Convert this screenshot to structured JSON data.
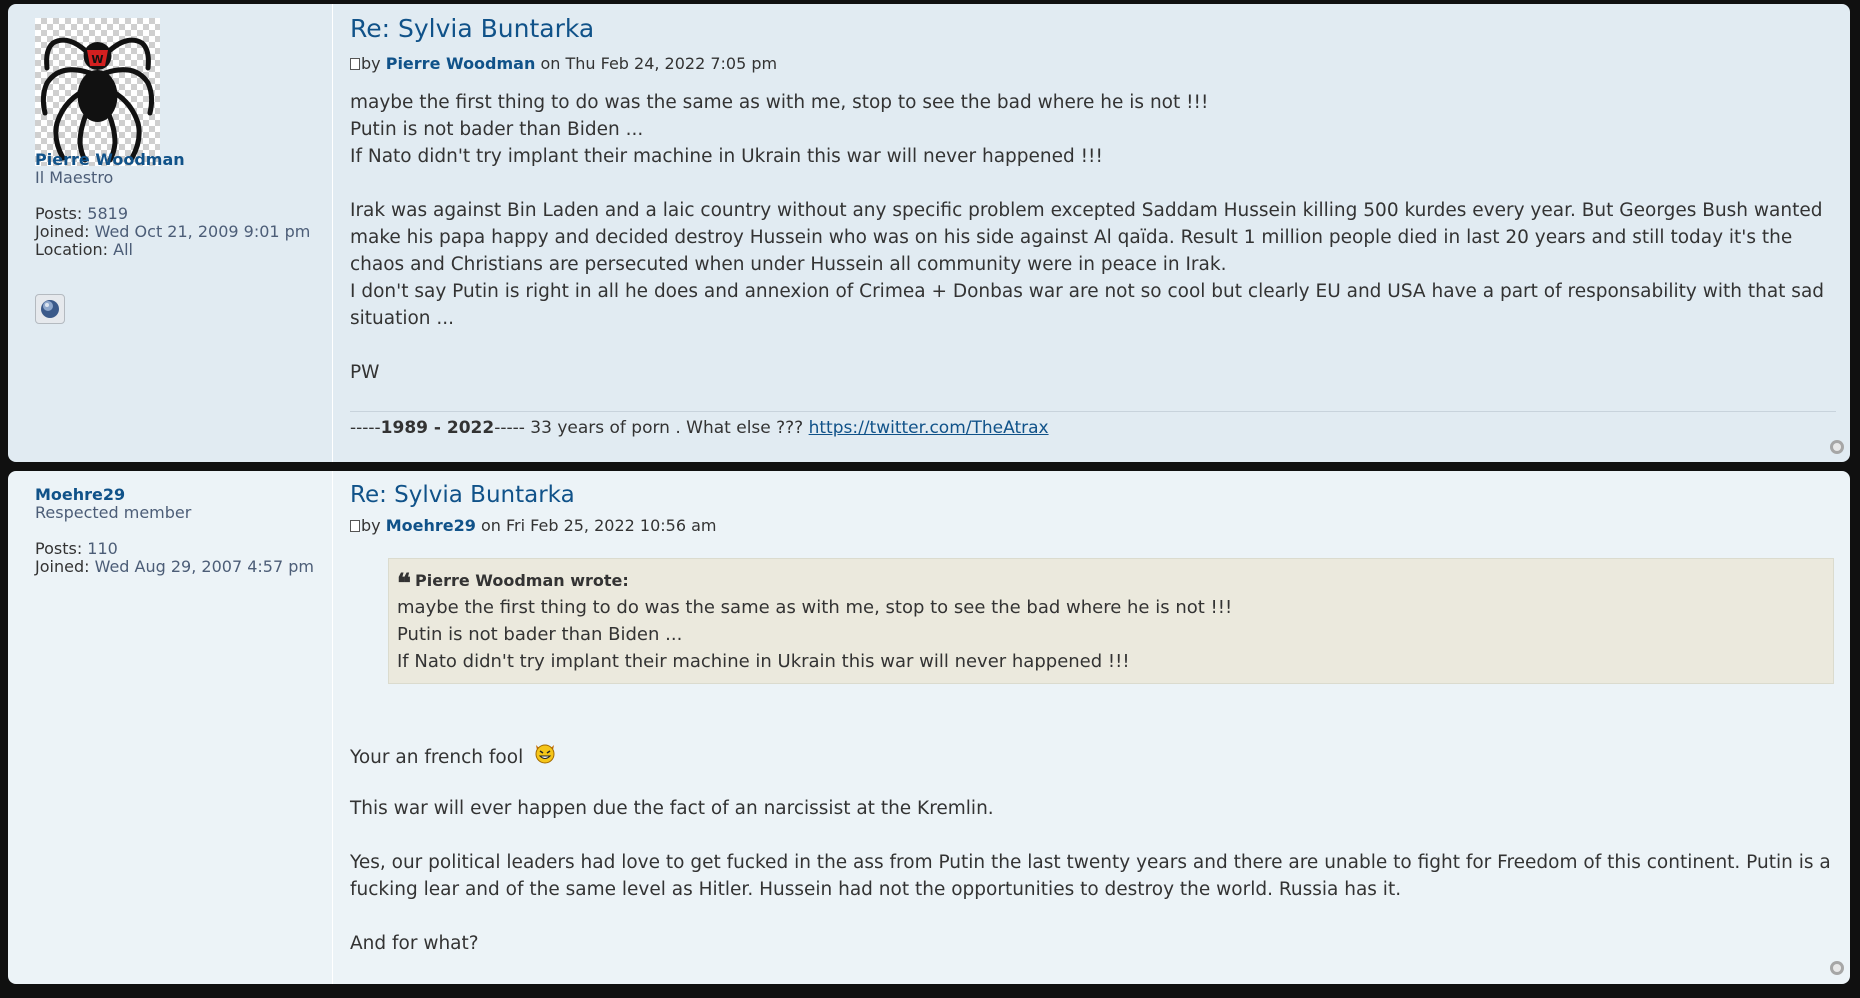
{
  "posts": [
    {
      "author": {
        "name": "Pierre Woodman",
        "rank": "Il Maestro",
        "posts_label": "Posts:",
        "posts": "5819",
        "joined_label": "Joined:",
        "joined": "Wed Oct 21, 2009 9:01 pm",
        "location_label": "Location:",
        "location": "All",
        "avatar_icon": "spider-icon",
        "website_icon": "globe-icon"
      },
      "title": "Re: Sylvia Buntarka",
      "meta": {
        "by": "by",
        "author": "Pierre Woodman",
        "date": "on Thu Feb 24, 2022 7:05 pm"
      },
      "content": {
        "line1": "maybe the first thing to do was the same as with me, stop to see the bad where he is not !!!",
        "line2": "Putin is not bader than Biden ...",
        "line3": "If Nato didn't try implant their machine in Ukrain this war will never happened !!!",
        "para1": "Irak was against Bin Laden and a laic country without any specific problem excepted Saddam Hussein killing 500 kurdes every year. But Georges Bush wanted make his papa happy and decided destroy Hussein who was on his side against Al qaïda. Result 1 million people died in last 20 years and still today it's the chaos and Christians are persecuted when under Hussein all community were in peace in Irak.",
        "para2": "I don't say Putin is right in all he does and annexion of Crimea + Donbas war are not so cool but clearly EU and USA have a part of responsability with that sad situation ...",
        "signoff": "PW"
      },
      "signature": {
        "prefix": "-----",
        "years": "1989 - 2022",
        "suffix": "----- 33 years of porn . What else ??? ",
        "link": "https://twitter.com/TheAtrax"
      }
    },
    {
      "author": {
        "name": "Moehre29",
        "rank": "Respected member",
        "posts_label": "Posts:",
        "posts": "110",
        "joined_label": "Joined:",
        "joined": "Wed Aug 29, 2007 4:57 pm"
      },
      "title": "Re: Sylvia Buntarka",
      "meta": {
        "by": "by",
        "author": "Moehre29",
        "date": "on Fri Feb 25, 2022 10:56 am"
      },
      "quote": {
        "cite": "Pierre Woodman wrote:",
        "line1": "maybe the first thing to do was the same as with me, stop to see the bad where he is not !!!",
        "line2": "Putin is not bader than Biden ...",
        "line3": "If Nato didn't try implant their machine in Ukrain this war will never happened !!!"
      },
      "content": {
        "line1": "Your an french fool",
        "smiley_icon": "evil-grin-smiley-icon",
        "line2": "This war will ever happen due the fact of an narcissist at the Kremlin.",
        "para1": "Yes, our political leaders had love to get fucked in the ass from Putin the last twenty years and there are unable to fight for Freedom of this continent. Putin is a fucking lear and of the same level as Hitler. Hussein had not the opportunities to destroy the world. Russia has it.",
        "line3": "And for what?"
      }
    }
  ],
  "colors": {
    "post_bg_1": "#e1ebf2",
    "post_bg_2": "#ecf3f7",
    "link": "#105289",
    "text": "#333333",
    "quote_bg": "#ebe9dd"
  }
}
